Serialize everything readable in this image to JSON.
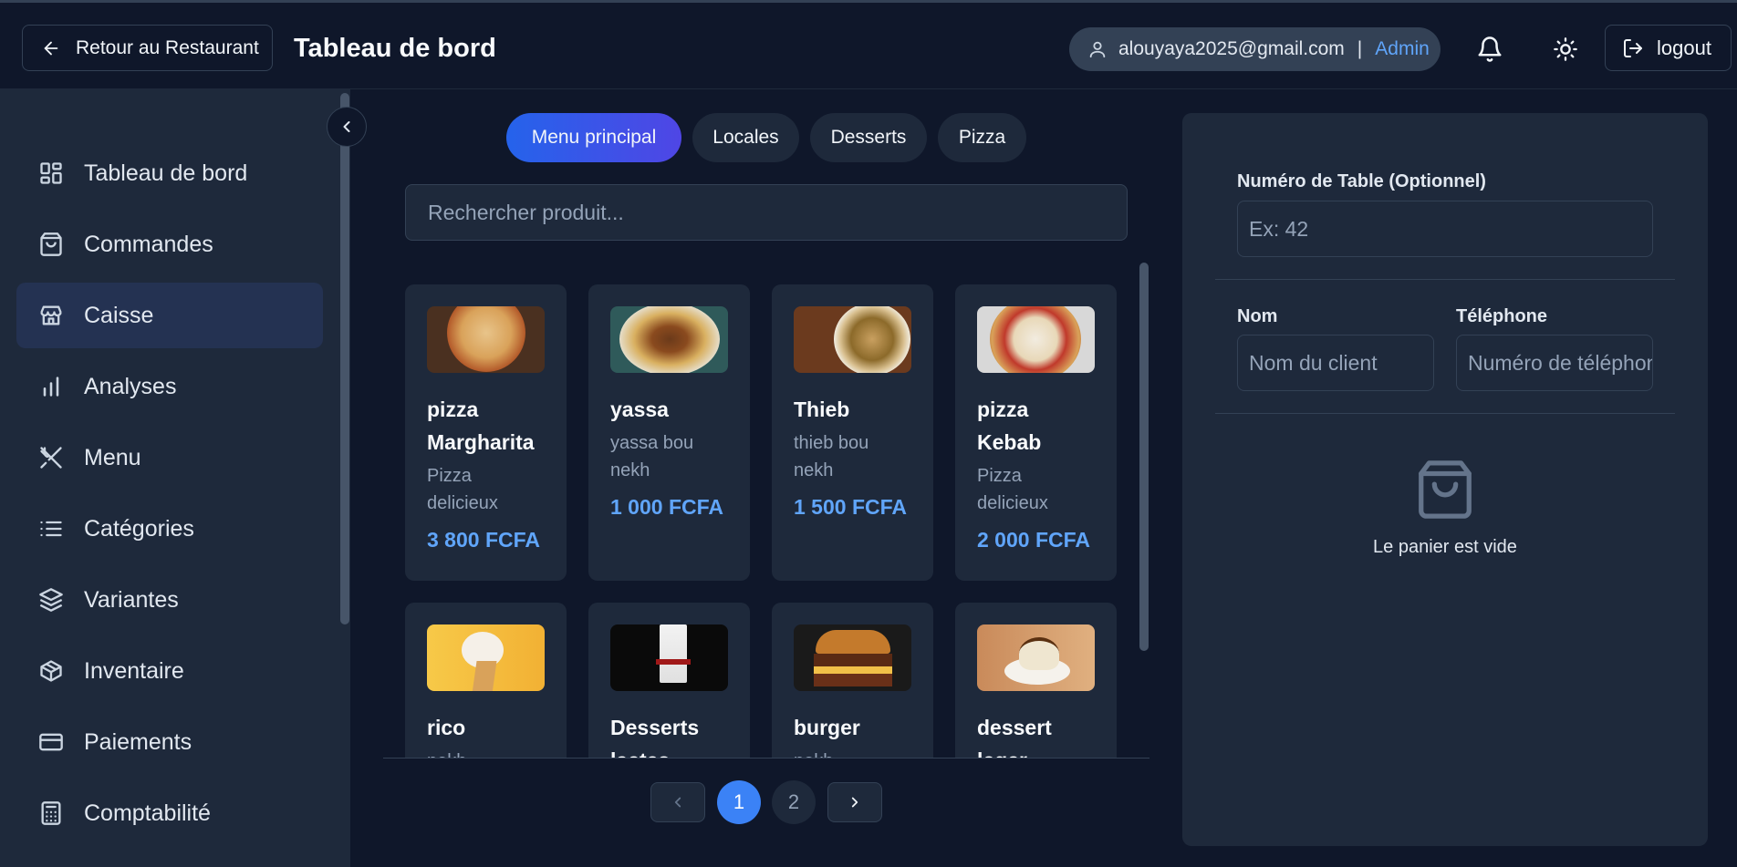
{
  "header": {
    "back_label": "Retour au Restaurant",
    "title": "Tableau de bord",
    "user_email": "alouyaya2025@gmail.com",
    "separator": "|",
    "user_role": "Admin",
    "logout_label": "logout"
  },
  "sidebar": {
    "items": [
      {
        "label": "Tableau de bord",
        "icon": "dashboard-icon"
      },
      {
        "label": "Commandes",
        "icon": "shopping-bag-icon"
      },
      {
        "label": "Caisse",
        "icon": "store-icon",
        "active": true
      },
      {
        "label": "Analyses",
        "icon": "bar-chart-icon"
      },
      {
        "label": "Menu",
        "icon": "utensils-icon"
      },
      {
        "label": "Catégories",
        "icon": "list-icon"
      },
      {
        "label": "Variantes",
        "icon": "layers-icon"
      },
      {
        "label": "Inventaire",
        "icon": "package-icon"
      },
      {
        "label": "Paiements",
        "icon": "credit-card-icon"
      },
      {
        "label": "Comptabilité",
        "icon": "calculator-icon"
      }
    ]
  },
  "tabs": [
    {
      "label": "Menu principal",
      "active": true
    },
    {
      "label": "Locales"
    },
    {
      "label": "Desserts"
    },
    {
      "label": "Pizza"
    }
  ],
  "search": {
    "placeholder": "Rechercher produit..."
  },
  "products": [
    {
      "name": "pizza Margharita",
      "desc": "Pizza delicieux",
      "price": "3 800 FCFA",
      "image": "pizza-image"
    },
    {
      "name": "yassa",
      "desc": "yassa bou nekh",
      "price": "1 000 FCFA",
      "image": "yassa-image"
    },
    {
      "name": "Thieb",
      "desc": "thieb bou nekh",
      "price": "1 500 FCFA",
      "image": "thieb-image"
    },
    {
      "name": "pizza Kebab",
      "desc": "Pizza delicieux",
      "price": "2 000 FCFA",
      "image": "pizza-kebab-image"
    },
    {
      "name": "rico",
      "desc": "nekh",
      "price": "",
      "image": "ice-cream-image"
    },
    {
      "name": "Desserts lactes",
      "desc": "",
      "price": "",
      "image": "dessert-drink-image"
    },
    {
      "name": "burger",
      "desc": "nekh",
      "price": "",
      "image": "burger-image"
    },
    {
      "name": "dessert leger",
      "desc": "",
      "price": "",
      "image": "dessert-image"
    }
  ],
  "pagination": {
    "pages": [
      "1",
      "2"
    ],
    "current": "1"
  },
  "order_panel": {
    "table_label": "Numéro de Table (Optionnel)",
    "table_placeholder": "Ex: 42",
    "name_label": "Nom",
    "name_placeholder": "Nom du client",
    "phone_label": "Téléphone",
    "phone_placeholder": "Numéro de téléphone",
    "empty_cart": "Le panier est vide"
  },
  "colors": {
    "accent": "#60a5fa",
    "active_tab": "#2563eb",
    "background": "#0f172a",
    "surface": "#1e293b"
  }
}
